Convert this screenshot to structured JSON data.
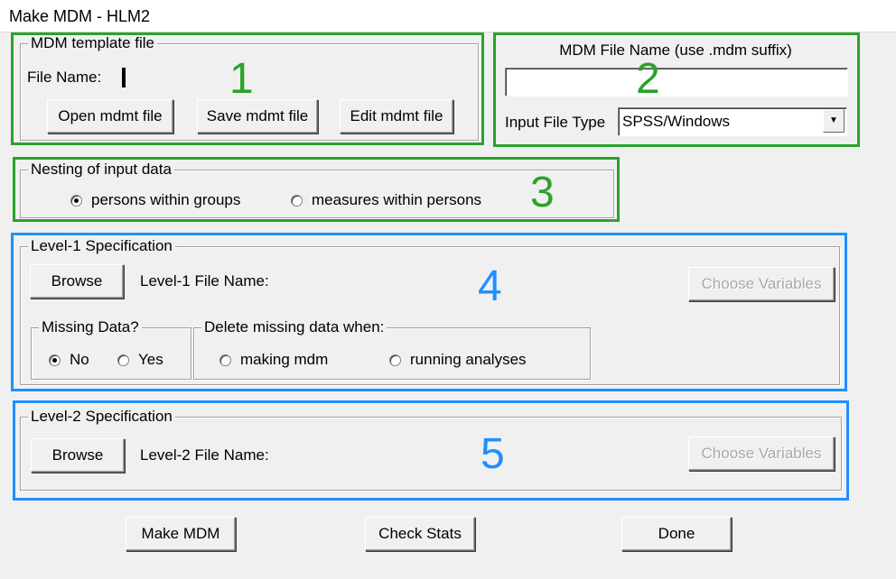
{
  "window": {
    "title": "Make MDM - HLM2"
  },
  "template": {
    "legend": "MDM template file",
    "file_name_label": "File Name:",
    "open_button": "Open mdmt file",
    "save_button": "Save mdmt file",
    "edit_button": "Edit mdmt file"
  },
  "mdm_file": {
    "label": "MDM File Name (use .mdm suffix)",
    "value": "",
    "input_type_label": "Input File Type",
    "input_type_value": "SPSS/Windows"
  },
  "nesting": {
    "legend": "Nesting of input data",
    "option_groups": "persons within groups",
    "option_measures": "measures within persons",
    "selected": "persons within groups"
  },
  "level1": {
    "legend": "Level-1 Specification",
    "browse_button": "Browse",
    "file_name_label": "Level-1 File Name:",
    "choose_variables_button": "Choose Variables",
    "missing_legend": "Missing Data?",
    "missing_no": "No",
    "missing_yes": "Yes",
    "missing_selected": "No",
    "delete_legend": "Delete missing data when:",
    "delete_making": "making mdm",
    "delete_running": "running analyses"
  },
  "level2": {
    "legend": "Level-2 Specification",
    "browse_button": "Browse",
    "file_name_label": "Level-2 File Name:",
    "choose_variables_button": "Choose Variables"
  },
  "footer": {
    "make_mdm_button": "Make MDM",
    "check_stats_button": "Check Stats",
    "done_button": "Done"
  },
  "annotations": {
    "n1": "1",
    "n2": "2",
    "n3": "3",
    "n4": "4",
    "n5": "5",
    "green_color": "#2aa32a",
    "blue_color": "#1e90ff"
  }
}
